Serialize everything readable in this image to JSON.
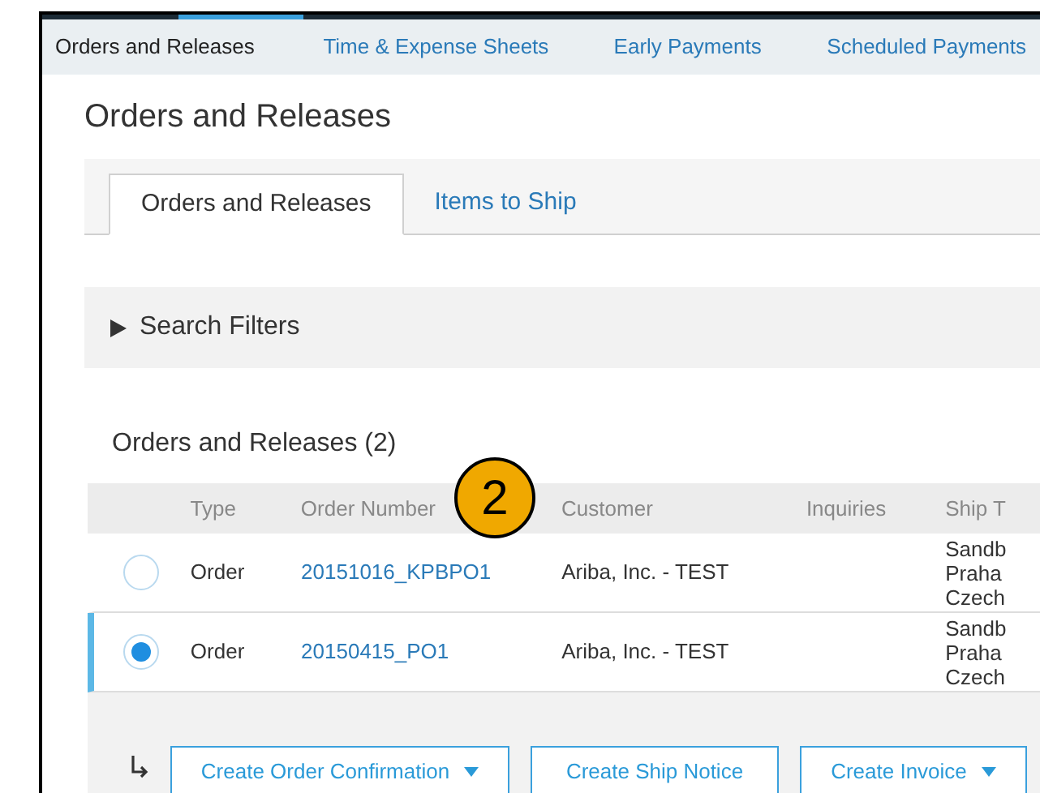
{
  "top_tabs": [
    {
      "label": "Orders and Releases",
      "selected": true
    },
    {
      "label": "Time & Expense Sheets",
      "selected": false
    },
    {
      "label": "Early Payments",
      "selected": false
    },
    {
      "label": "Scheduled Payments",
      "selected": false
    }
  ],
  "page_title": "Orders and Releases",
  "sub_tabs": [
    {
      "label": "Orders and Releases",
      "selected": true
    },
    {
      "label": "Items to Ship",
      "selected": false
    }
  ],
  "search_filters": {
    "label": "Search Filters",
    "expanded": false
  },
  "table": {
    "title": "Orders and Releases (2)",
    "columns": [
      "Type",
      "Order Number",
      "Customer",
      "Inquiries",
      "Ship T"
    ],
    "rows": [
      {
        "selected": false,
        "type": "Order",
        "order_number": "20151016_KPBPO1",
        "customer": "Ariba, Inc. - TEST",
        "ship_to": [
          "Sandb",
          "Praha",
          "Czech"
        ]
      },
      {
        "selected": true,
        "type": "Order",
        "order_number": "20150415_PO1",
        "customer": "Ariba, Inc. - TEST",
        "ship_to": [
          "Sandb",
          "Praha",
          "Czech"
        ]
      }
    ]
  },
  "actions": [
    {
      "label": "Create Order Confirmation",
      "dropdown": true
    },
    {
      "label": "Create Ship Notice",
      "dropdown": false
    },
    {
      "label": "Create Invoice",
      "dropdown": true
    }
  ],
  "callout": "2"
}
